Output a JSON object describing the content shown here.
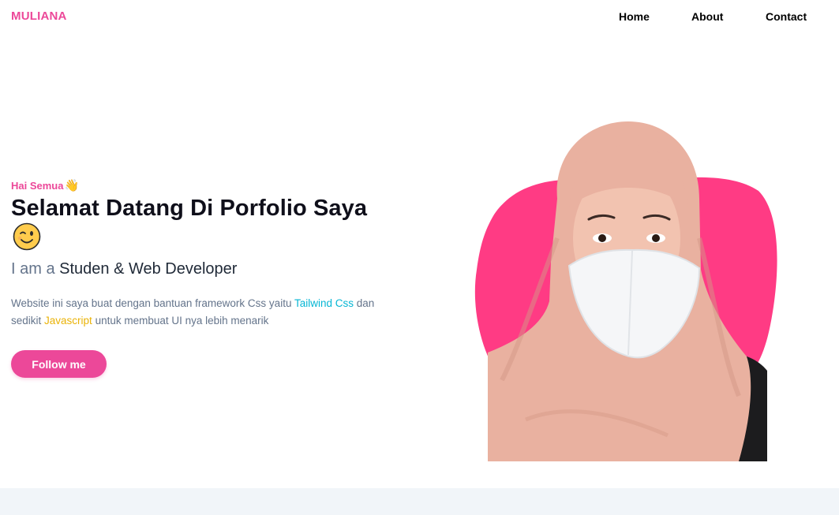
{
  "nav": {
    "brand": "MULIANA",
    "links": [
      {
        "label": "Home"
      },
      {
        "label": "About"
      },
      {
        "label": "Contact"
      }
    ]
  },
  "hero": {
    "greeting": "Hai Semua",
    "greeting_emoji": "👋",
    "title": "Selamat Datang Di Porfolio Saya",
    "subtitle_prefix": "I am a",
    "subtitle_role": "Studen & Web Developer",
    "desc_part1": "Website ini saya buat dengan bantuan framework Css yaitu ",
    "desc_link1": "Tailwind Css",
    "desc_part2": " dan sedikit ",
    "desc_link2": "Javascript",
    "desc_part3": " untuk membuat UI nya lebih menarik",
    "cta_label": "Follow me"
  },
  "icons": {
    "wave": "waving-hand-icon",
    "wink": "winking-face-icon"
  },
  "colors": {
    "accent": "#ec4899",
    "blob": "#ff3b84",
    "tailwind": "#06b6d4",
    "javascript": "#eab308",
    "muted": "#64748b",
    "footer_band": "#f1f5f9"
  }
}
